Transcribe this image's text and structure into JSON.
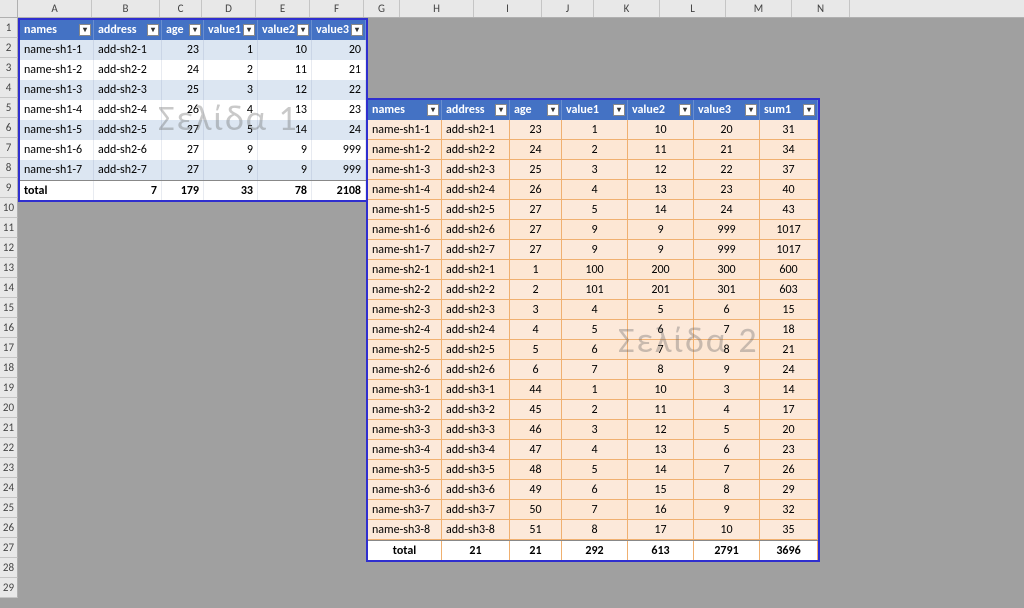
{
  "columns": [
    "A",
    "B",
    "C",
    "D",
    "E",
    "F",
    "G",
    "H",
    "I",
    "J",
    "K",
    "L",
    "M",
    "N"
  ],
  "row_count": 29,
  "watermarks": {
    "page1": "Σελίδα 1",
    "page2": "Σελίδα 2"
  },
  "table1": {
    "headers": [
      "names",
      "address",
      "age",
      "value1",
      "value2",
      "value3"
    ],
    "rows": [
      {
        "name": "name-sh1-1",
        "addr": "add-sh2-1",
        "age": 23,
        "v1": 1,
        "v2": 10,
        "v3": 20
      },
      {
        "name": "name-sh1-2",
        "addr": "add-sh2-2",
        "age": 24,
        "v1": 2,
        "v2": 11,
        "v3": 21
      },
      {
        "name": "name-sh1-3",
        "addr": "add-sh2-3",
        "age": 25,
        "v1": 3,
        "v2": 12,
        "v3": 22
      },
      {
        "name": "name-sh1-4",
        "addr": "add-sh2-4",
        "age": 26,
        "v1": 4,
        "v2": 13,
        "v3": 23
      },
      {
        "name": "name-sh1-5",
        "addr": "add-sh2-5",
        "age": 27,
        "v1": 5,
        "v2": 14,
        "v3": 24
      },
      {
        "name": "name-sh1-6",
        "addr": "add-sh2-6",
        "age": 27,
        "v1": 9,
        "v2": 9,
        "v3": 999
      },
      {
        "name": "name-sh1-7",
        "addr": "add-sh2-7",
        "age": 27,
        "v1": 9,
        "v2": 9,
        "v3": 999
      }
    ],
    "total": {
      "label": "total",
      "addr": 7,
      "age": 179,
      "v1": 33,
      "v2": 78,
      "v3": 2108
    }
  },
  "table2": {
    "headers": [
      "names",
      "address",
      "age",
      "value1",
      "value2",
      "value3",
      "sum1"
    ],
    "rows": [
      {
        "name": "name-sh1-1",
        "addr": "add-sh2-1",
        "age": 23,
        "v1": 1,
        "v2": 10,
        "v3": 20,
        "sum": 31
      },
      {
        "name": "name-sh1-2",
        "addr": "add-sh2-2",
        "age": 24,
        "v1": 2,
        "v2": 11,
        "v3": 21,
        "sum": 34
      },
      {
        "name": "name-sh1-3",
        "addr": "add-sh2-3",
        "age": 25,
        "v1": 3,
        "v2": 12,
        "v3": 22,
        "sum": 37
      },
      {
        "name": "name-sh1-4",
        "addr": "add-sh2-4",
        "age": 26,
        "v1": 4,
        "v2": 13,
        "v3": 23,
        "sum": 40
      },
      {
        "name": "name-sh1-5",
        "addr": "add-sh2-5",
        "age": 27,
        "v1": 5,
        "v2": 14,
        "v3": 24,
        "sum": 43
      },
      {
        "name": "name-sh1-6",
        "addr": "add-sh2-6",
        "age": 27,
        "v1": 9,
        "v2": 9,
        "v3": 999,
        "sum": 1017
      },
      {
        "name": "name-sh1-7",
        "addr": "add-sh2-7",
        "age": 27,
        "v1": 9,
        "v2": 9,
        "v3": 999,
        "sum": 1017
      },
      {
        "name": "name-sh2-1",
        "addr": "add-sh2-1",
        "age": 1,
        "v1": 100,
        "v2": 200,
        "v3": 300,
        "sum": 600
      },
      {
        "name": "name-sh2-2",
        "addr": "add-sh2-2",
        "age": 2,
        "v1": 101,
        "v2": 201,
        "v3": 301,
        "sum": 603
      },
      {
        "name": "name-sh2-3",
        "addr": "add-sh2-3",
        "age": 3,
        "v1": 4,
        "v2": 5,
        "v3": 6,
        "sum": 15
      },
      {
        "name": "name-sh2-4",
        "addr": "add-sh2-4",
        "age": 4,
        "v1": 5,
        "v2": 6,
        "v3": 7,
        "sum": 18
      },
      {
        "name": "name-sh2-5",
        "addr": "add-sh2-5",
        "age": 5,
        "v1": 6,
        "v2": 7,
        "v3": 8,
        "sum": 21
      },
      {
        "name": "name-sh2-6",
        "addr": "add-sh2-6",
        "age": 6,
        "v1": 7,
        "v2": 8,
        "v3": 9,
        "sum": 24
      },
      {
        "name": "name-sh3-1",
        "addr": "add-sh3-1",
        "age": 44,
        "v1": 1,
        "v2": 10,
        "v3": 3,
        "sum": 14
      },
      {
        "name": "name-sh3-2",
        "addr": "add-sh3-2",
        "age": 45,
        "v1": 2,
        "v2": 11,
        "v3": 4,
        "sum": 17
      },
      {
        "name": "name-sh3-3",
        "addr": "add-sh3-3",
        "age": 46,
        "v1": 3,
        "v2": 12,
        "v3": 5,
        "sum": 20
      },
      {
        "name": "name-sh3-4",
        "addr": "add-sh3-4",
        "age": 47,
        "v1": 4,
        "v2": 13,
        "v3": 6,
        "sum": 23
      },
      {
        "name": "name-sh3-5",
        "addr": "add-sh3-5",
        "age": 48,
        "v1": 5,
        "v2": 14,
        "v3": 7,
        "sum": 26
      },
      {
        "name": "name-sh3-6",
        "addr": "add-sh3-6",
        "age": 49,
        "v1": 6,
        "v2": 15,
        "v3": 8,
        "sum": 29
      },
      {
        "name": "name-sh3-7",
        "addr": "add-sh3-7",
        "age": 50,
        "v1": 7,
        "v2": 16,
        "v3": 9,
        "sum": 32
      },
      {
        "name": "name-sh3-8",
        "addr": "add-sh3-8",
        "age": 51,
        "v1": 8,
        "v2": 17,
        "v3": 10,
        "sum": 35
      }
    ],
    "total": {
      "label": "total",
      "addr": 21,
      "age": 21,
      "v1": 292,
      "v2": 613,
      "v3": 2791,
      "sum": 3696
    }
  }
}
